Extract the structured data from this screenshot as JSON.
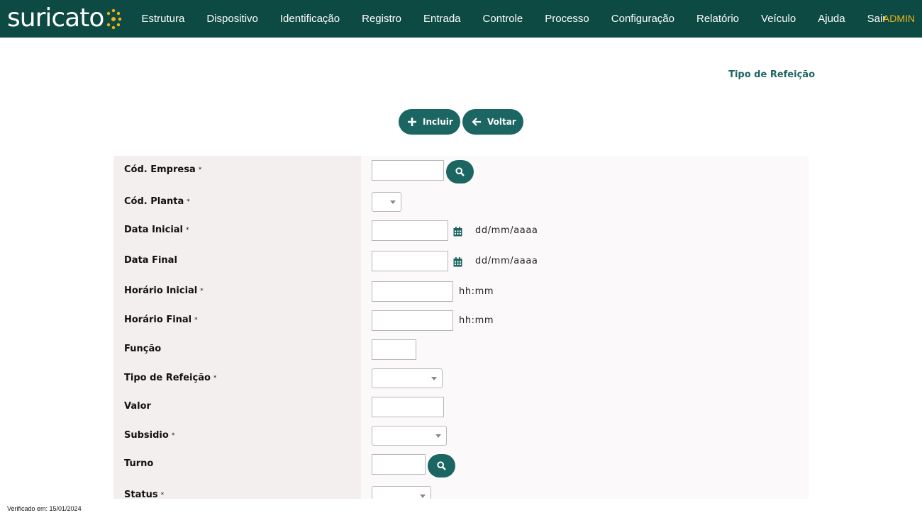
{
  "brand": {
    "name": "suricato"
  },
  "nav": {
    "items": [
      "Estrutura",
      "Dispositivo",
      "Identificação",
      "Registro",
      "Entrada",
      "Controle",
      "Processo",
      "Configuração",
      "Relatório",
      "Veículo",
      "Ajuda",
      "Sair"
    ],
    "user": "ADMIN"
  },
  "page": {
    "title": "Tipo de Refeição"
  },
  "actions": {
    "include_label": "Incluir",
    "back_label": "Voltar"
  },
  "form": {
    "required_mark": "*",
    "fields": {
      "cod_empresa": {
        "label": "Cód. Empresa",
        "value": ""
      },
      "cod_planta": {
        "label": "Cód. Planta",
        "value": ""
      },
      "data_inicial": {
        "label": "Data Inicial",
        "value": "",
        "hint": "dd/mm/aaaa"
      },
      "data_final": {
        "label": "Data Final",
        "value": "",
        "hint": "dd/mm/aaaa"
      },
      "horario_inicial": {
        "label": "Horário Inicial",
        "value": "",
        "hint": "hh:mm"
      },
      "horario_final": {
        "label": "Horário Final",
        "value": "",
        "hint": "hh:mm"
      },
      "funcao": {
        "label": "Função",
        "value": ""
      },
      "tipo_refeicao": {
        "label": "Tipo de Refeição",
        "value": ""
      },
      "valor": {
        "label": "Valor",
        "value": ""
      },
      "subsidio": {
        "label": "Subsidio",
        "value": ""
      },
      "turno": {
        "label": "Turno",
        "value": ""
      },
      "status": {
        "label": "Status",
        "value": ""
      }
    }
  },
  "footer": {
    "verified": "Verificado em: 15/01/2024"
  },
  "colors": {
    "header_bg": "#0d4a43",
    "accent": "#1b6562",
    "admin": "#f0b31a",
    "logo_dot": "#f0b31a"
  },
  "icons": [
    "plus-icon",
    "arrow-left-icon",
    "search-icon",
    "calendar-icon",
    "chevron-down-icon"
  ]
}
